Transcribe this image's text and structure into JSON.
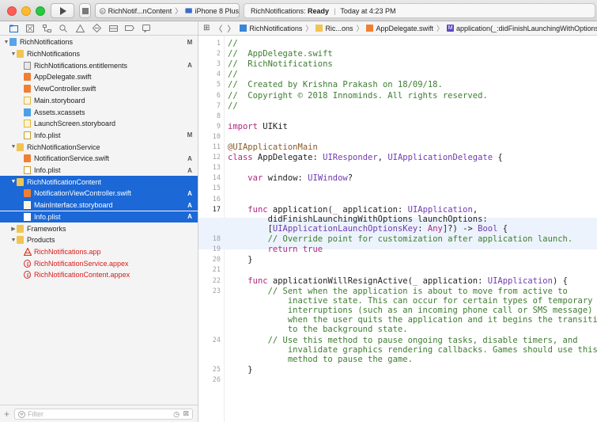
{
  "toolbar": {
    "scheme_target": "RichNotif...nContent",
    "scheme_device": "iPhone 8 Plus",
    "status_project": "RichNotifications:",
    "status_state": "Ready",
    "status_time": "Today at 4:23 PM"
  },
  "navigator": {
    "rows": [
      {
        "label": "RichNotifications",
        "badge": "M",
        "indent": 0,
        "icon": "project-icon",
        "disclosure": "▼"
      },
      {
        "label": "RichNotifications",
        "badge": "",
        "indent": 1,
        "icon": "folder-icon",
        "disclosure": "▼"
      },
      {
        "label": "RichNotifications.entitlements",
        "badge": "A",
        "indent": 2,
        "icon": "entitlements-icon",
        "disclosure": ""
      },
      {
        "label": "AppDelegate.swift",
        "badge": "",
        "indent": 2,
        "icon": "swift-file-icon",
        "disclosure": ""
      },
      {
        "label": "ViewController.swift",
        "badge": "",
        "indent": 2,
        "icon": "swift-file-icon",
        "disclosure": ""
      },
      {
        "label": "Main.storyboard",
        "badge": "",
        "indent": 2,
        "icon": "storyboard-icon",
        "disclosure": ""
      },
      {
        "label": "Assets.xcassets",
        "badge": "",
        "indent": 2,
        "icon": "asset-catalog-icon",
        "disclosure": ""
      },
      {
        "label": "LaunchScreen.storyboard",
        "badge": "",
        "indent": 2,
        "icon": "storyboard-icon",
        "disclosure": ""
      },
      {
        "label": "Info.plist",
        "badge": "M",
        "indent": 2,
        "icon": "plist-icon",
        "disclosure": ""
      },
      {
        "label": "RichNotificationService",
        "badge": "",
        "indent": 1,
        "icon": "folder-icon",
        "disclosure": "▼"
      },
      {
        "label": "NotificationService.swift",
        "badge": "A",
        "indent": 2,
        "icon": "swift-file-icon",
        "disclosure": ""
      },
      {
        "label": "Info.plist",
        "badge": "A",
        "indent": 2,
        "icon": "plist-icon",
        "disclosure": ""
      },
      {
        "label": "RichNotificationContent",
        "badge": "",
        "indent": 1,
        "icon": "folder-icon",
        "disclosure": "▼",
        "selected": true
      },
      {
        "label": "NotificationViewController.swift",
        "badge": "A",
        "indent": 2,
        "icon": "swift-file-icon",
        "disclosure": "",
        "selected": true
      },
      {
        "label": "MainInterface.storyboard",
        "badge": "A",
        "indent": 2,
        "icon": "storyboard-icon",
        "disclosure": "",
        "selected": true
      },
      {
        "label": "Info.plist",
        "badge": "A",
        "indent": 2,
        "icon": "plist-icon",
        "disclosure": "",
        "selected": true
      },
      {
        "label": "Frameworks",
        "badge": "",
        "indent": 1,
        "icon": "folder-icon",
        "disclosure": "▶"
      },
      {
        "label": "Products",
        "badge": "",
        "indent": 1,
        "icon": "folder-icon",
        "disclosure": "▼"
      },
      {
        "label": "RichNotifications.app",
        "badge": "",
        "indent": 2,
        "icon": "app-icon",
        "disclosure": "",
        "red": true
      },
      {
        "label": "RichNotificationService.appex",
        "badge": "",
        "indent": 2,
        "icon": "extension-icon",
        "disclosure": "",
        "red": true
      },
      {
        "label": "RichNotificationContent.appex",
        "badge": "",
        "indent": 2,
        "icon": "extension-icon",
        "disclosure": "",
        "red": true
      }
    ],
    "filter_placeholder": "Filter"
  },
  "jumpbar": {
    "crumbs": [
      "RichNotifications",
      "Ric...ons",
      "AppDelegate.swift",
      "application(_:didFinishLaunchingWithOptions:)"
    ]
  },
  "editor": {
    "lines": [
      {
        "n": "1",
        "html": "<span class=\"cm\">//</span>"
      },
      {
        "n": "2",
        "html": "<span class=\"cm\">//  AppDelegate.swift</span>"
      },
      {
        "n": "3",
        "html": "<span class=\"cm\">//  RichNotifications</span>"
      },
      {
        "n": "4",
        "html": "<span class=\"cm\">//</span>"
      },
      {
        "n": "5",
        "html": "<span class=\"cm\">//  Created by Krishna Prakash on 18/09/18.</span>"
      },
      {
        "n": "6",
        "html": "<span class=\"cm\">//  Copyright © 2018 Innominds. All rights reserved.</span>"
      },
      {
        "n": "7",
        "html": "<span class=\"cm\">//</span>"
      },
      {
        "n": "8",
        "html": ""
      },
      {
        "n": "9",
        "html": "<span class=\"kw\">import</span> UIKit"
      },
      {
        "n": "10",
        "html": ""
      },
      {
        "n": "11",
        "html": "<span class=\"at\">@UIApplicationMain</span>"
      },
      {
        "n": "12",
        "html": "<span class=\"kw\">class</span> AppDelegate: <span class=\"ty\">UIResponder</span>, <span class=\"ty\">UIApplicationDelegate</span> {"
      },
      {
        "n": "13",
        "html": ""
      },
      {
        "n": "14",
        "html": "    <span class=\"kw\">var</span> window: <span class=\"ty\">UIWindow</span>?"
      },
      {
        "n": "15",
        "html": ""
      },
      {
        "n": "16",
        "html": ""
      },
      {
        "n": "17",
        "html": "    <span class=\"kw\">func</span> application(<span class=\"kw\">_</span> application: <span class=\"ty\">UIApplication</span>,\n        didFinishLaunchingWithOptions launchOptions:\n        [<span class=\"ty\">UIApplicationLaunchOptionsKey</span>: <span class=\"kw\">Any</span>]?) -> <span class=\"ty\">Bool</span> {",
        "cur": true
      },
      {
        "n": "18",
        "html": "        <span class=\"cm\">// Override point for customization after application launch.</span>"
      },
      {
        "n": "19",
        "html": "        <span class=\"kw\">return true</span>"
      },
      {
        "n": "20",
        "html": "    }"
      },
      {
        "n": "21",
        "html": ""
      },
      {
        "n": "22",
        "html": "    <span class=\"kw\">func</span> applicationWillResignActive(<span class=\"kw\">_</span> application: <span class=\"ty\">UIApplication</span>) {"
      },
      {
        "n": "23",
        "html": "        <span class=\"cm\">// Sent when the application is about to move from active to\n            inactive state. This can occur for certain types of temporary\n            interruptions (such as an incoming phone call or SMS message) or\n            when the user quits the application and it begins the transition\n            to the background state.</span>"
      },
      {
        "n": "24",
        "html": "        <span class=\"cm\">// Use this method to pause ongoing tasks, disable timers, and\n            invalidate graphics rendering callbacks. Games should use this\n            method to pause the game.</span>"
      },
      {
        "n": "25",
        "html": "    }"
      },
      {
        "n": "26",
        "html": ""
      }
    ]
  }
}
